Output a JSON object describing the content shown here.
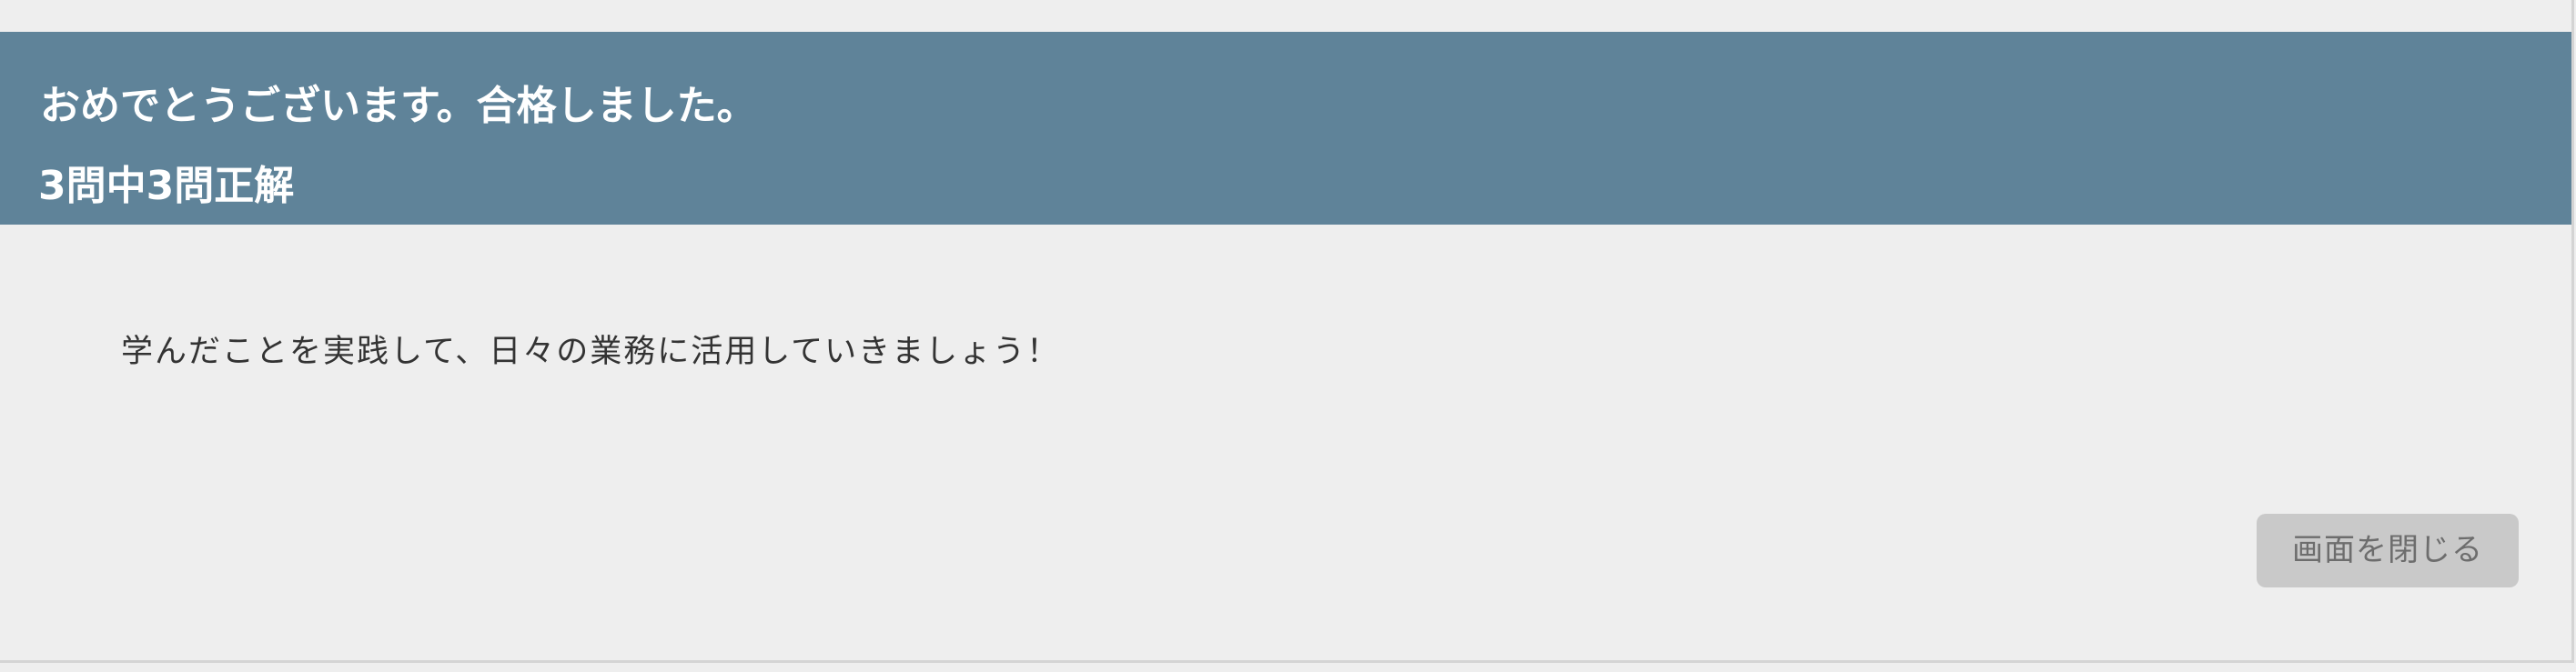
{
  "result": {
    "title": "おめでとうございます。合格しました。",
    "score": "3問中3問正解"
  },
  "message": "学んだことを実践して、日々の業務に活用していきましょう！",
  "actions": {
    "close_label": "画面を閉じる"
  },
  "colors": {
    "header_background": "#5f8399",
    "page_background": "#eeeeee",
    "button_background": "#c9c9c9",
    "button_text": "#6d6d6d"
  }
}
